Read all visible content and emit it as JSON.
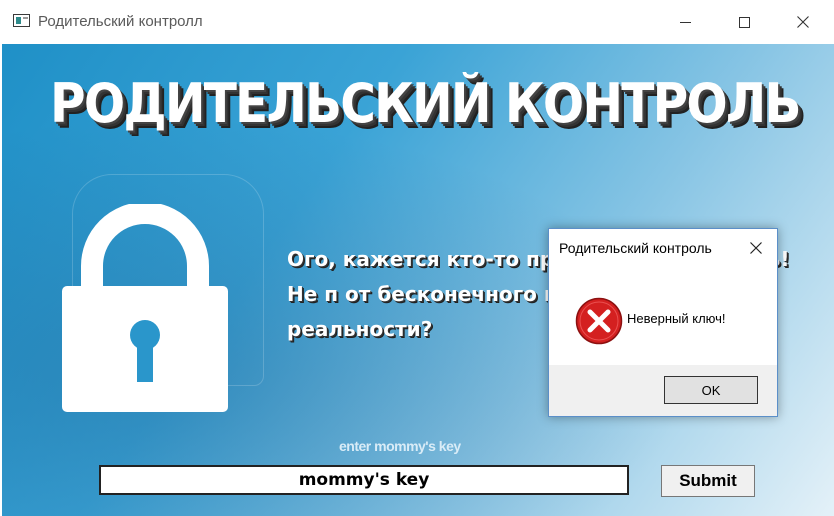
{
  "window": {
    "title": "Родительский контролл",
    "icon": "app-window-icon",
    "controls": [
      "minimize-icon",
      "maximize-icon",
      "close-icon"
    ]
  },
  "main": {
    "headline": "РОДИТЕЛЬСКИЙ КОНТРОЛЬ",
    "lock_icon": "padlock-icon",
    "message": "Ого, кажется кто-то пр                            е всю свою юность! Не п                            от бесконечного потока м                         к реальности?",
    "key_label": "enter mommy's key",
    "key_input_value": "mommy's key",
    "submit_label": "Submit",
    "colors": {
      "background_start": "#1f90c7",
      "background_end": "#e4f1f8",
      "text": "#ffffff"
    }
  },
  "dialog": {
    "title": "Родительский контроль",
    "icon": "error-icon",
    "message": "Неверный ключ!",
    "ok_label": "OK",
    "colors": {
      "error_red": "#d42020",
      "footer": "#f0f0f0"
    }
  }
}
